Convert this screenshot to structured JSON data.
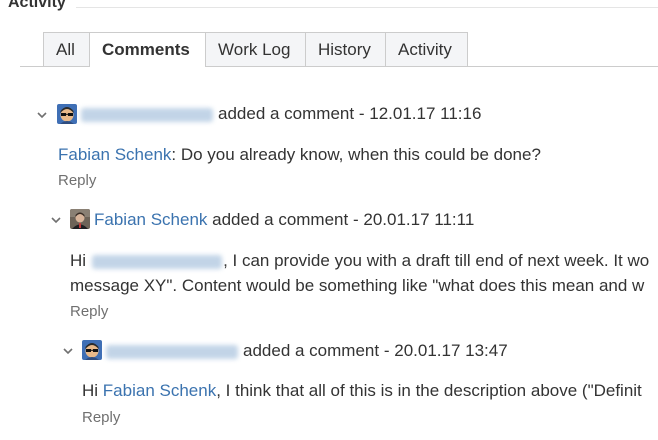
{
  "section": {
    "title": "Activity"
  },
  "tabs": [
    {
      "label": "All",
      "active": false
    },
    {
      "label": "Comments",
      "active": true
    },
    {
      "label": "Work Log",
      "active": false
    },
    {
      "label": "History",
      "active": false
    },
    {
      "label": "Activity",
      "active": false
    }
  ],
  "comments": [
    {
      "author": "Reinhold Kessler",
      "author_redacted": true,
      "action": "added a comment",
      "separator": "-",
      "timestamp": "12.01.17 11:16",
      "body": {
        "mention": "Fabian Schenk",
        "text": ": Do you already know, when this could be done?"
      },
      "reply_label": "Reply",
      "avatar_icon": "avatar-sunglasses-icon"
    },
    {
      "author": "Fabian Schenk",
      "author_redacted": false,
      "action": "added a comment",
      "separator": "-",
      "timestamp": "20.01.17 11:11",
      "body": {
        "greeting": "Hi",
        "mention_redacted": "Reinhold Kessler",
        "line1_rest": ", I can provide you with a draft till end of next week. It wo",
        "line2": "message XY\". Content would be something like \"what does this mean and w"
      },
      "reply_label": "Reply",
      "avatar_icon": "avatar-photo-icon"
    },
    {
      "author": "Reinhold Kessler",
      "author_redacted": true,
      "action": "added a comment",
      "separator": "-",
      "timestamp": "20.01.17 13:47",
      "body": {
        "greeting": "Hi",
        "mention": "Fabian Schenk",
        "text": ", I think that all of this is in the description above (\"Definit"
      },
      "reply_label": "Reply",
      "avatar_icon": "avatar-sunglasses-icon"
    }
  ],
  "colors": {
    "link": "#3b73af",
    "text": "#333333",
    "muted": "#707070",
    "tab_border": "#cccccc",
    "tab_bg": "#f4f5f7"
  }
}
